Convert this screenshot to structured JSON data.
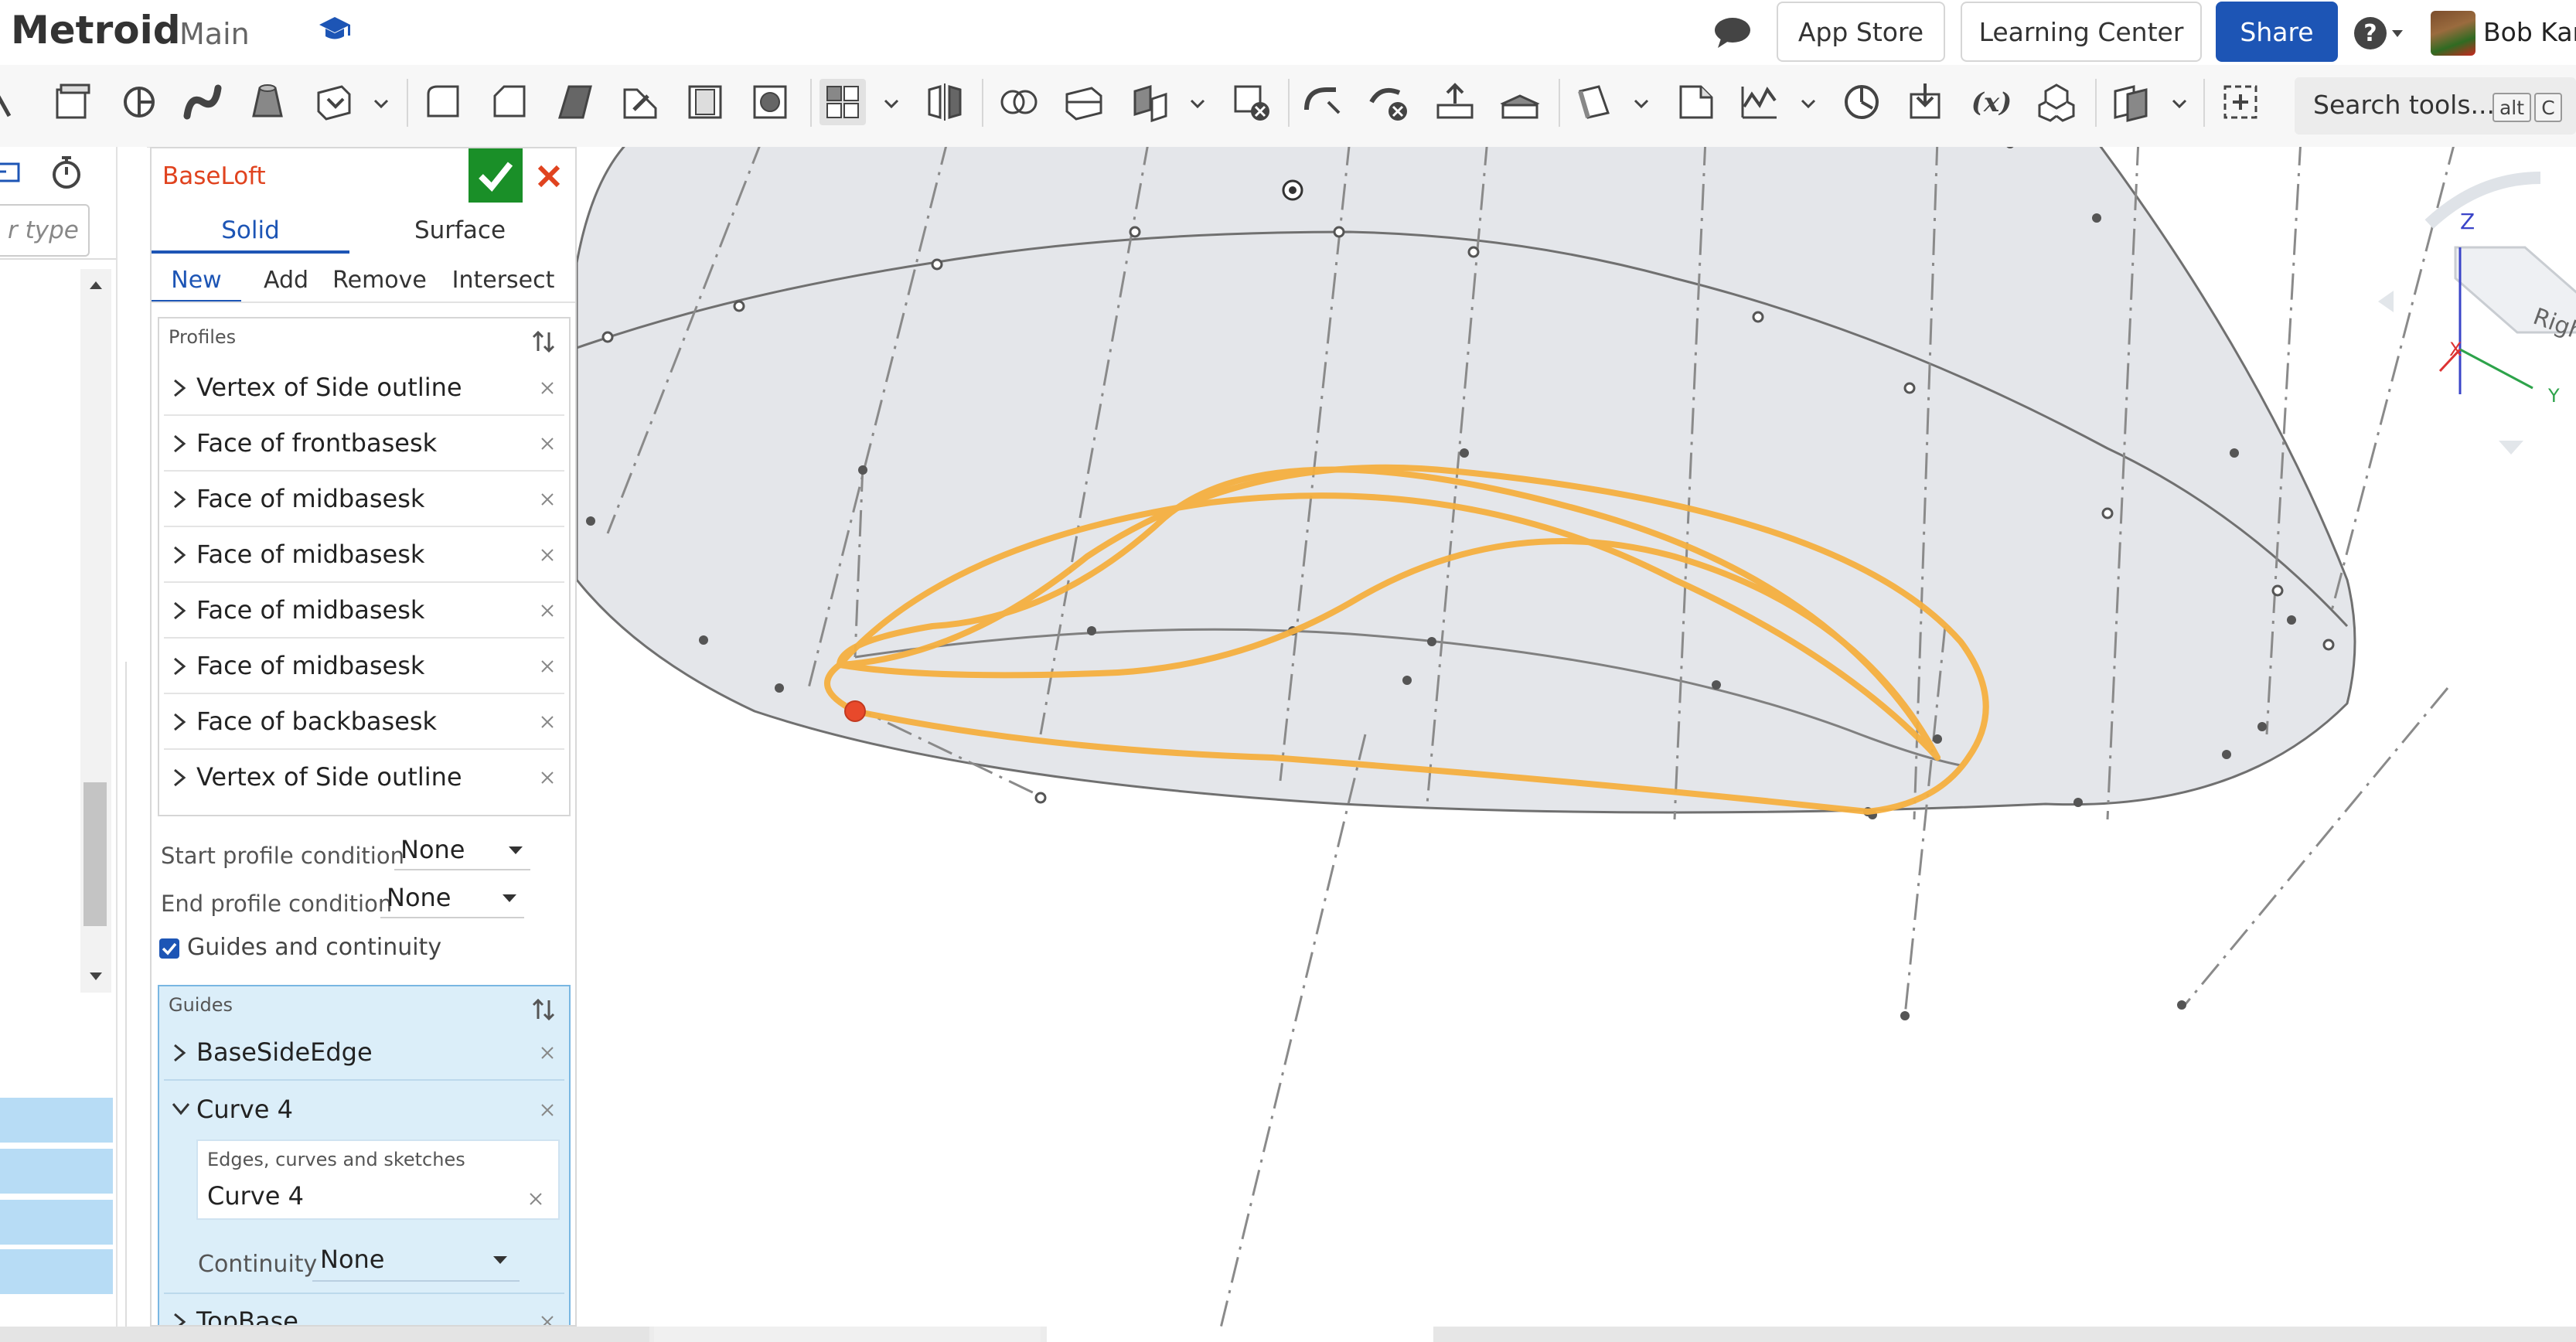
{
  "header": {
    "doc_title": "Metroid",
    "workspace": "Main",
    "app_store": "App Store",
    "learning_center": "Learning Center",
    "share": "Share",
    "user_name": "Bob Kar"
  },
  "toolbar": {
    "search_label": "Search tools...",
    "shortcut_key1": "alt",
    "shortcut_key2": "C",
    "variable_label": "(x)"
  },
  "tree": {
    "search_placeholder": "r type"
  },
  "feature": {
    "title": "BaseLoft",
    "tabs": [
      "Solid",
      "Surface"
    ],
    "operations": [
      "New",
      "Add",
      "Remove",
      "Intersect"
    ],
    "profiles_header": "Profiles",
    "profiles": [
      "Vertex of Side outline",
      "Face of frontbasesk",
      "Face of midbasesk",
      "Face of midbasesk",
      "Face of midbasesk",
      "Face of midbasesk",
      "Face of backbasesk",
      "Vertex of Side outline"
    ],
    "start_condition_label": "Start profile condition",
    "start_condition_value": "None",
    "end_condition_label": "End profile condition",
    "end_condition_value": "None",
    "guides_checkbox_label": "Guides and continuity",
    "guides_checked": true,
    "guides_header": "Guides",
    "guides": [
      "BaseSideEdge",
      "Curve 4",
      "TopBase"
    ],
    "curve4_sub_header": "Edges, curves and sketches",
    "curve4_sub_value": "Curve 4",
    "continuity_label": "Continuity",
    "continuity_value": "None"
  },
  "view_cube": {
    "face_label": "Right",
    "axis_z": "Z",
    "axis_x": "X",
    "axis_y": "Y"
  },
  "colors": {
    "accent": "#1d55b5",
    "ok_green": "#1a8f28",
    "cancel_red": "#e0431f",
    "guide_orange": "#f5b040",
    "selected_blue": "#dbeef9"
  }
}
